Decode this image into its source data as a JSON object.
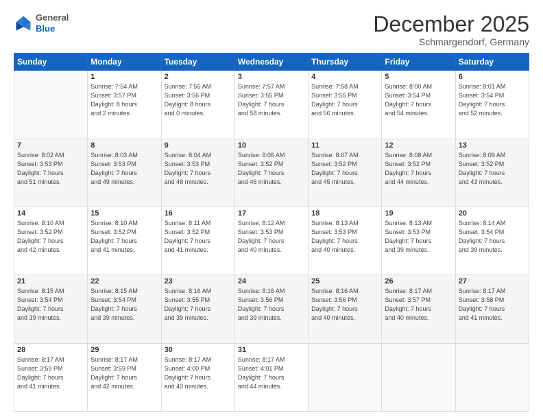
{
  "header": {
    "logo_general": "General",
    "logo_blue": "Blue",
    "month_title": "December 2025",
    "location": "Schmargendorf, Germany"
  },
  "days_of_week": [
    "Sunday",
    "Monday",
    "Tuesday",
    "Wednesday",
    "Thursday",
    "Friday",
    "Saturday"
  ],
  "weeks": [
    [
      {
        "day": "",
        "info": ""
      },
      {
        "day": "1",
        "info": "Sunrise: 7:54 AM\nSunset: 3:57 PM\nDaylight: 8 hours\nand 2 minutes."
      },
      {
        "day": "2",
        "info": "Sunrise: 7:55 AM\nSunset: 3:56 PM\nDaylight: 8 hours\nand 0 minutes."
      },
      {
        "day": "3",
        "info": "Sunrise: 7:57 AM\nSunset: 3:55 PM\nDaylight: 7 hours\nand 58 minutes."
      },
      {
        "day": "4",
        "info": "Sunrise: 7:58 AM\nSunset: 3:55 PM\nDaylight: 7 hours\nand 56 minutes."
      },
      {
        "day": "5",
        "info": "Sunrise: 8:00 AM\nSunset: 3:54 PM\nDaylight: 7 hours\nand 54 minutes."
      },
      {
        "day": "6",
        "info": "Sunrise: 8:01 AM\nSunset: 3:54 PM\nDaylight: 7 hours\nand 52 minutes."
      }
    ],
    [
      {
        "day": "7",
        "info": "Sunrise: 8:02 AM\nSunset: 3:53 PM\nDaylight: 7 hours\nand 51 minutes."
      },
      {
        "day": "8",
        "info": "Sunrise: 8:03 AM\nSunset: 3:53 PM\nDaylight: 7 hours\nand 49 minutes."
      },
      {
        "day": "9",
        "info": "Sunrise: 8:04 AM\nSunset: 3:53 PM\nDaylight: 7 hours\nand 48 minutes."
      },
      {
        "day": "10",
        "info": "Sunrise: 8:06 AM\nSunset: 3:52 PM\nDaylight: 7 hours\nand 46 minutes."
      },
      {
        "day": "11",
        "info": "Sunrise: 8:07 AM\nSunset: 3:52 PM\nDaylight: 7 hours\nand 45 minutes."
      },
      {
        "day": "12",
        "info": "Sunrise: 8:08 AM\nSunset: 3:52 PM\nDaylight: 7 hours\nand 44 minutes."
      },
      {
        "day": "13",
        "info": "Sunrise: 8:09 AM\nSunset: 3:52 PM\nDaylight: 7 hours\nand 43 minutes."
      }
    ],
    [
      {
        "day": "14",
        "info": "Sunrise: 8:10 AM\nSunset: 3:52 PM\nDaylight: 7 hours\nand 42 minutes."
      },
      {
        "day": "15",
        "info": "Sunrise: 8:10 AM\nSunset: 3:52 PM\nDaylight: 7 hours\nand 41 minutes."
      },
      {
        "day": "16",
        "info": "Sunrise: 8:11 AM\nSunset: 3:52 PM\nDaylight: 7 hours\nand 41 minutes."
      },
      {
        "day": "17",
        "info": "Sunrise: 8:12 AM\nSunset: 3:53 PM\nDaylight: 7 hours\nand 40 minutes."
      },
      {
        "day": "18",
        "info": "Sunrise: 8:13 AM\nSunset: 3:53 PM\nDaylight: 7 hours\nand 40 minutes."
      },
      {
        "day": "19",
        "info": "Sunrise: 8:13 AM\nSunset: 3:53 PM\nDaylight: 7 hours\nand 39 minutes."
      },
      {
        "day": "20",
        "info": "Sunrise: 8:14 AM\nSunset: 3:54 PM\nDaylight: 7 hours\nand 39 minutes."
      }
    ],
    [
      {
        "day": "21",
        "info": "Sunrise: 8:15 AM\nSunset: 3:54 PM\nDaylight: 7 hours\nand 39 minutes."
      },
      {
        "day": "22",
        "info": "Sunrise: 8:15 AM\nSunset: 3:54 PM\nDaylight: 7 hours\nand 39 minutes."
      },
      {
        "day": "23",
        "info": "Sunrise: 8:16 AM\nSunset: 3:55 PM\nDaylight: 7 hours\nand 39 minutes."
      },
      {
        "day": "24",
        "info": "Sunrise: 8:16 AM\nSunset: 3:56 PM\nDaylight: 7 hours\nand 39 minutes."
      },
      {
        "day": "25",
        "info": "Sunrise: 8:16 AM\nSunset: 3:56 PM\nDaylight: 7 hours\nand 40 minutes."
      },
      {
        "day": "26",
        "info": "Sunrise: 8:17 AM\nSunset: 3:57 PM\nDaylight: 7 hours\nand 40 minutes."
      },
      {
        "day": "27",
        "info": "Sunrise: 8:17 AM\nSunset: 3:58 PM\nDaylight: 7 hours\nand 41 minutes."
      }
    ],
    [
      {
        "day": "28",
        "info": "Sunrise: 8:17 AM\nSunset: 3:59 PM\nDaylight: 7 hours\nand 41 minutes."
      },
      {
        "day": "29",
        "info": "Sunrise: 8:17 AM\nSunset: 3:59 PM\nDaylight: 7 hours\nand 42 minutes."
      },
      {
        "day": "30",
        "info": "Sunrise: 8:17 AM\nSunset: 4:00 PM\nDaylight: 7 hours\nand 43 minutes."
      },
      {
        "day": "31",
        "info": "Sunrise: 8:17 AM\nSunset: 4:01 PM\nDaylight: 7 hours\nand 44 minutes."
      },
      {
        "day": "",
        "info": ""
      },
      {
        "day": "",
        "info": ""
      },
      {
        "day": "",
        "info": ""
      }
    ]
  ]
}
